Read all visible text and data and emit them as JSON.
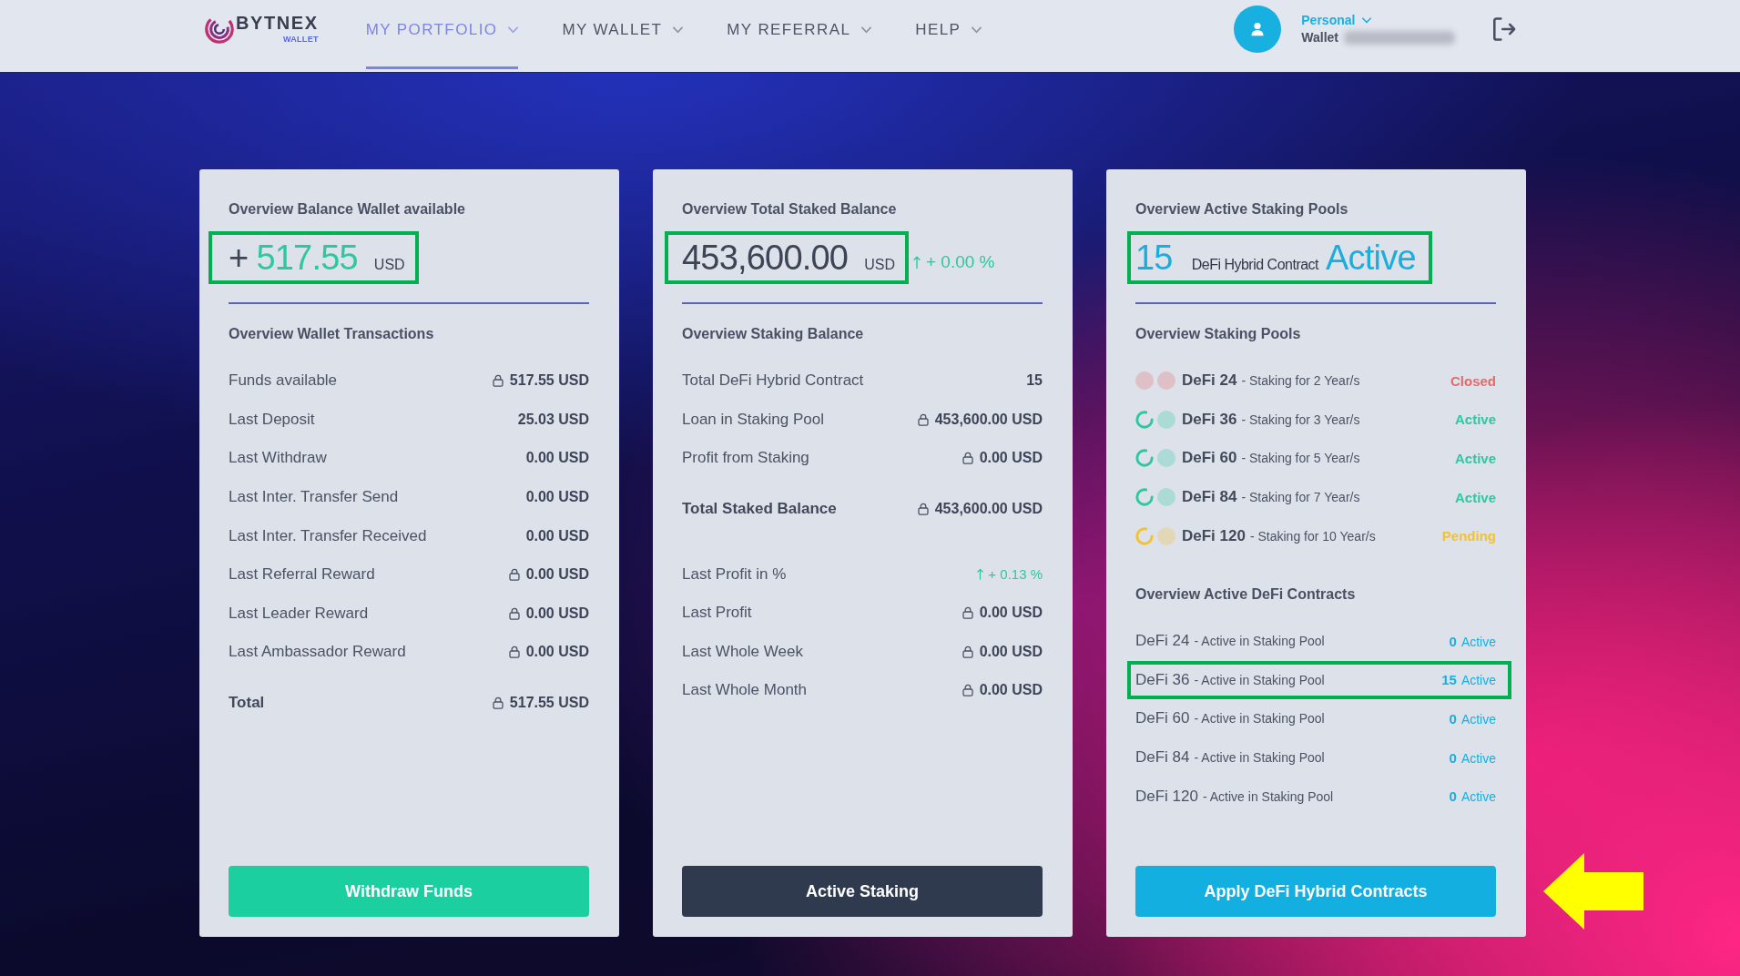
{
  "header": {
    "logo": {
      "name": "BYTNEX",
      "subtitle": "WALLET"
    },
    "nav": [
      {
        "label": "MY PORTFOLIO",
        "selected": true
      },
      {
        "label": "MY WALLET",
        "selected": false
      },
      {
        "label": "MY REFERRAL",
        "selected": false
      },
      {
        "label": "HELP",
        "selected": false
      }
    ],
    "account": {
      "type": "Personal",
      "label": "Wallet",
      "expanded": false
    }
  },
  "wallet_card": {
    "title": "Overview Balance Wallet available",
    "headline": {
      "sign": "+",
      "amount": "517.55",
      "unit": "USD",
      "highlighted": true
    },
    "section_title": "Overview Wallet Transactions",
    "rows": [
      {
        "label": "Funds available",
        "value": "517.55 USD",
        "kind": "locked",
        "total": false
      },
      {
        "label": "Last Deposit",
        "value": "25.03 USD",
        "kind": "plain",
        "total": false
      },
      {
        "label": "Last Withdraw",
        "value": "0.00 USD",
        "kind": "plain",
        "total": false
      },
      {
        "label": "Last Inter. Transfer Send",
        "value": "0.00 USD",
        "kind": "plain",
        "total": false
      },
      {
        "label": "Last Inter. Transfer Received",
        "value": "0.00 USD",
        "kind": "plain",
        "total": false
      },
      {
        "label": "Last Referral Reward",
        "value": "0.00 USD",
        "kind": "locked",
        "total": false
      },
      {
        "label": "Last Leader Reward",
        "value": "0.00 USD",
        "kind": "locked",
        "total": false
      },
      {
        "label": "Last Ambassador Reward",
        "value": "0.00 USD",
        "kind": "locked",
        "total": false
      },
      {
        "label": "Total",
        "value": "517.55 USD",
        "kind": "locked",
        "total": true
      }
    ],
    "button": "Withdraw Funds"
  },
  "staking_card": {
    "title": "Overview Total Staked Balance",
    "headline": {
      "amount": "453,600.00",
      "unit": "USD",
      "change": "+ 0.00 %",
      "highlighted": true
    },
    "section_title": "Overview Staking Balance",
    "rows": [
      {
        "label": "Total DeFi Hybrid Contract",
        "value": "15",
        "kind": "plain",
        "total": false
      },
      {
        "label": "Loan in Staking Pool",
        "value": "453,600.00 USD",
        "kind": "locked",
        "total": false
      },
      {
        "label": "Profit from Staking",
        "value": "0.00 USD",
        "kind": "locked",
        "total": false
      },
      {
        "label": "Total Staked Balance",
        "value": "453,600.00 USD",
        "kind": "locked",
        "total": true
      },
      {
        "label": "Last Profit in %",
        "value": "+ 0.13 %",
        "kind": "change",
        "total": false
      },
      {
        "label": "Last Profit",
        "value": "0.00 USD",
        "kind": "locked",
        "total": false
      },
      {
        "label": "Last Whole Week",
        "value": "0.00 USD",
        "kind": "locked",
        "total": false
      },
      {
        "label": "Last Whole Month",
        "value": "0.00 USD",
        "kind": "locked",
        "total": false
      }
    ],
    "button": "Active Staking"
  },
  "pools_card": {
    "title": "Overview Active Staking Pools",
    "headline": {
      "count": "15",
      "label": "DeFi Hybrid Contract",
      "status": "Active",
      "highlighted": true
    },
    "pools_title": "Overview Staking Pools",
    "pools": [
      {
        "name": "DeFi 24",
        "term": "- Staking for 2 Year/s",
        "status": "Closed",
        "color": "#e46a6a",
        "spinning": false
      },
      {
        "name": "DeFi 36",
        "term": "- Staking for 3 Year/s",
        "status": "Active",
        "color": "#2ec7a2",
        "spinning": true
      },
      {
        "name": "DeFi 60",
        "term": "- Staking for 5 Year/s",
        "status": "Active",
        "color": "#2ec7a2",
        "spinning": true
      },
      {
        "name": "DeFi 84",
        "term": "- Staking for 7 Year/s",
        "status": "Active",
        "color": "#2ec7a2",
        "spinning": true
      },
      {
        "name": "DeFi 120",
        "term": "- Staking for 10 Year/s",
        "status": "Pending",
        "color": "#f2c230",
        "spinning": true
      }
    ],
    "contracts_title": "Overview Active DeFi Contracts",
    "contracts": [
      {
        "name": "DeFi 24",
        "detail": "- Active in Staking Pool",
        "count": "0",
        "status": "Active",
        "highlighted": false
      },
      {
        "name": "DeFi 36",
        "detail": "- Active in Staking Pool",
        "count": "15",
        "status": "Active",
        "highlighted": true
      },
      {
        "name": "DeFi 60",
        "detail": "- Active in Staking Pool",
        "count": "0",
        "status": "Active",
        "highlighted": false
      },
      {
        "name": "DeFi 84",
        "detail": "- Active in Staking Pool",
        "count": "0",
        "status": "Active",
        "highlighted": false
      },
      {
        "name": "DeFi 120",
        "detail": "- Active in Staking Pool",
        "count": "0",
        "status": "Active",
        "highlighted": false
      }
    ],
    "button": "Apply DeFi Hybrid Contracts"
  }
}
